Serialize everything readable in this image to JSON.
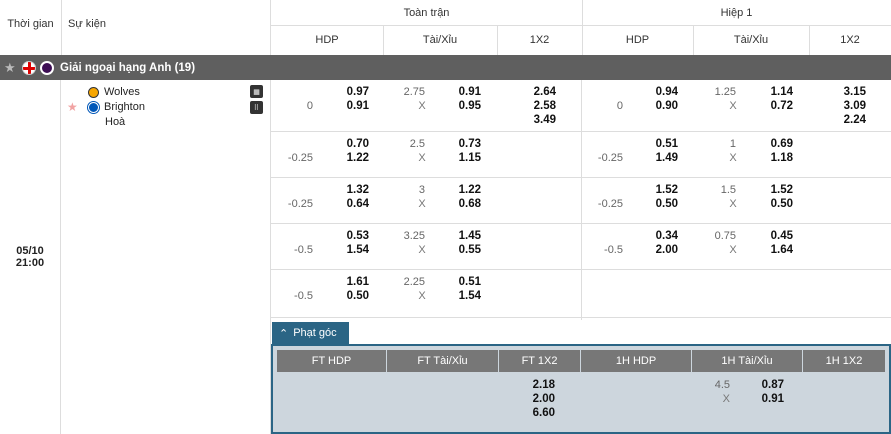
{
  "header": {
    "time_label": "Thời gian",
    "event_label": "Sự kiện",
    "full_match": "Toàn trận",
    "half1": "Hiệp 1",
    "sub": [
      "HDP",
      "Tài/Xỉu",
      "1X2",
      "HDP",
      "Tài/Xỉu",
      "1X2"
    ]
  },
  "league": {
    "name": "Giải ngoại hạng Anh (19)"
  },
  "match": {
    "date": "05/10",
    "time": "21:00",
    "home": "Wolves",
    "away": "Brighton",
    "draw": "Hoà"
  },
  "rows": [
    {
      "ft_hdp": "0",
      "ft_hdp_h": "0.97",
      "ft_hdp_a": "0.91",
      "ft_ou": "2.75",
      "ft_ou_x": "X",
      "ft_ou_o": "0.91",
      "ft_ou_u": "0.95",
      "ft_1": "2.64",
      "ft_2": "2.58",
      "ft_x": "3.49",
      "h1_hdp": "0",
      "h1_hdp_h": "0.94",
      "h1_hdp_a": "0.90",
      "h1_ou": "1.25",
      "h1_ou_x": "X",
      "h1_ou_o": "1.14",
      "h1_ou_u": "0.72",
      "h1_1": "3.15",
      "h1_2": "3.09",
      "h1_x": "2.24"
    },
    {
      "ft_hdp": "-0.25",
      "ft_hdp_h": "0.70",
      "ft_hdp_a": "1.22",
      "ft_ou": "2.5",
      "ft_ou_x": "X",
      "ft_ou_o": "0.73",
      "ft_ou_u": "1.15",
      "h1_hdp": "-0.25",
      "h1_hdp_h": "0.51",
      "h1_hdp_a": "1.49",
      "h1_ou": "1",
      "h1_ou_x": "X",
      "h1_ou_o": "0.69",
      "h1_ou_u": "1.18"
    },
    {
      "ft_hdp": "-0.25",
      "ft_hdp_h": "1.32",
      "ft_hdp_a": "0.64",
      "ft_ou": "3",
      "ft_ou_x": "X",
      "ft_ou_o": "1.22",
      "ft_ou_u": "0.68",
      "h1_hdp": "-0.25",
      "h1_hdp_h": "1.52",
      "h1_hdp_a": "0.50",
      "h1_ou": "1.5",
      "h1_ou_x": "X",
      "h1_ou_o": "1.52",
      "h1_ou_u": "0.50"
    },
    {
      "ft_hdp": "-0.5",
      "ft_hdp_h": "0.53",
      "ft_hdp_a": "1.54",
      "ft_ou": "3.25",
      "ft_ou_x": "X",
      "ft_ou_o": "1.45",
      "ft_ou_u": "0.55",
      "h1_hdp": "-0.5",
      "h1_hdp_h": "0.34",
      "h1_hdp_a": "2.00",
      "h1_ou": "0.75",
      "h1_ou_x": "X",
      "h1_ou_o": "0.45",
      "h1_ou_u": "1.64"
    },
    {
      "ft_hdp": "-0.5",
      "ft_hdp_h": "1.61",
      "ft_hdp_a": "0.50",
      "ft_ou": "2.25",
      "ft_ou_x": "X",
      "ft_ou_o": "0.51",
      "ft_ou_u": "1.54"
    }
  ],
  "corners": {
    "tab_label": "Phạt góc",
    "headers": [
      "FT HDP",
      "FT Tài/Xỉu",
      "FT 1X2",
      "1H HDP",
      "1H Tài/Xỉu",
      "1H 1X2"
    ],
    "ft_1": "2.18",
    "ft_2": "2.00",
    "ft_x": "6.60",
    "h1_ou": "4.5",
    "h1_ou_x": "X",
    "h1_ou_o": "0.87",
    "h1_ou_u": "0.91"
  },
  "colors": {
    "league_bar": "#5f5f5f",
    "corner_accent": "#2b6585",
    "corner_bg": "#cdd6dd"
  }
}
